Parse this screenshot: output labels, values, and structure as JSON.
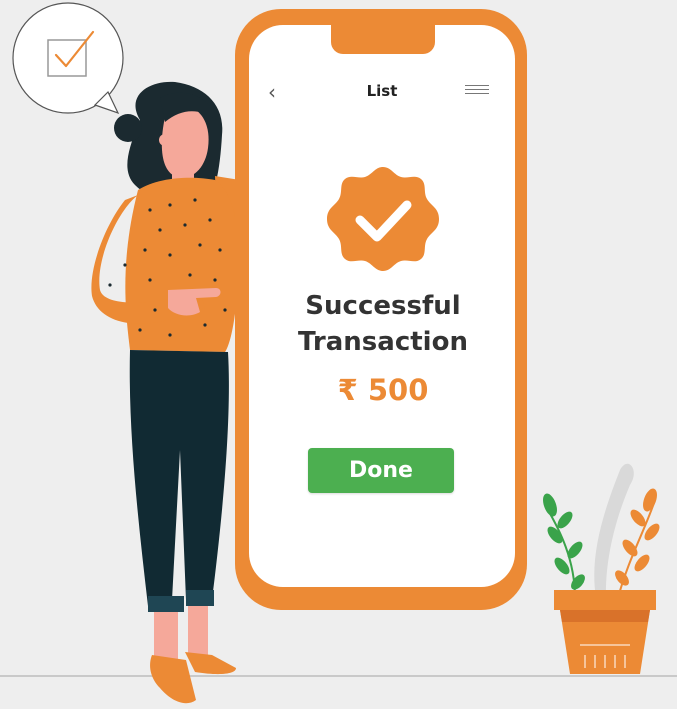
{
  "screen": {
    "title": "List",
    "back_icon": "‹",
    "success_line1": "Successful",
    "success_line2": "Transaction",
    "amount": "₹ 500",
    "done_label": "Done"
  },
  "icons": {
    "back": "chevron-left-icon",
    "menu": "hamburger-menu-icon",
    "badge": "verified-check-badge-icon",
    "speech": "checkbox-icon"
  },
  "colors": {
    "accent": "#ec8a35",
    "success": "#4caf50",
    "background": "#eeeeee"
  }
}
